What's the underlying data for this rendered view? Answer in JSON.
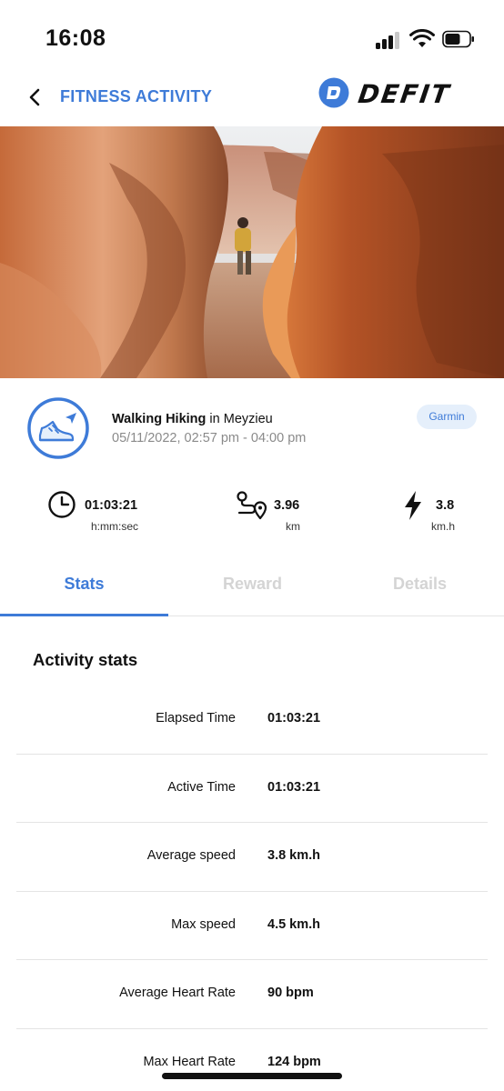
{
  "status_bar": {
    "time": "16:08",
    "icons": [
      "signal-icon",
      "wifi-icon",
      "battery-icon"
    ]
  },
  "header": {
    "back_icon": "chevron-left-icon",
    "title": "FITNESS ACTIVITY",
    "brand_name": "DEFIT",
    "brand_logo": "defit-logo",
    "accent_color": "#3e7bd8"
  },
  "hero": {
    "image": "canyon-hiker-photo"
  },
  "activity": {
    "icon": "hiking-shoe-icon",
    "type": "Walking Hiking",
    "location_prefix": "in",
    "location": "Meyzieu",
    "date_range": "05/11/2022, 02:57 pm - 04:00 pm",
    "source": "Garmin"
  },
  "summary": {
    "duration": {
      "icon": "clock-icon",
      "value": "01:03:21",
      "unit": "h:mm:sec"
    },
    "distance": {
      "icon": "route-icon",
      "value": "3.96",
      "unit": "km"
    },
    "speed": {
      "icon": "lightning-icon",
      "value": "3.8",
      "unit": "km.h"
    }
  },
  "tabs": [
    {
      "label": "Stats",
      "active": true
    },
    {
      "label": "Reward",
      "active": false
    },
    {
      "label": "Details",
      "active": false
    }
  ],
  "stats": {
    "title": "Activity stats",
    "rows": [
      {
        "label": "Elapsed Time",
        "value": "01:03:21"
      },
      {
        "label": "Active Time",
        "value": "01:03:21"
      },
      {
        "label": "Average speed",
        "value": "3.8 km.h"
      },
      {
        "label": "Max speed",
        "value": "4.5 km.h"
      },
      {
        "label": "Average Heart Rate",
        "value": "90 bpm"
      },
      {
        "label": "Max Heart Rate",
        "value": "124 bpm"
      }
    ]
  }
}
